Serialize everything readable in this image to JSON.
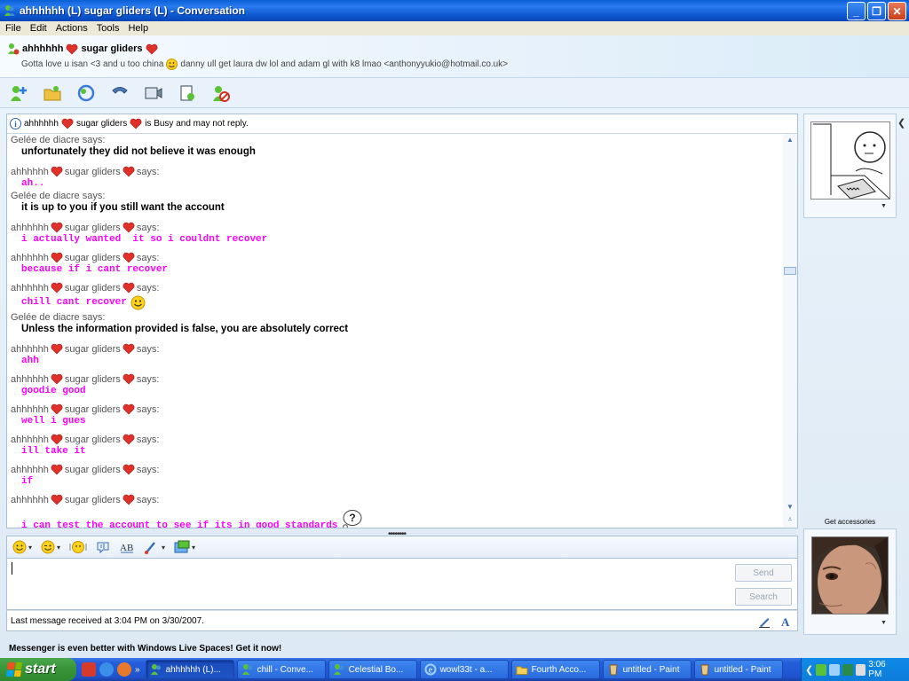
{
  "window": {
    "title": "ahhhhhh (L) sugar gliders (L) - Conversation",
    "controls": [
      "minimize",
      "maximize",
      "close"
    ]
  },
  "menu": [
    "File",
    "Edit",
    "Actions",
    "Tools",
    "Help"
  ],
  "contact": {
    "name_part1": "ahhhhhh",
    "name_part2": "sugar gliders",
    "status_part1": "Gotta love u isan <3 and u too china",
    "status_part2": "danny ull get laura dw lol and adam gl with k8 lmao <anthonyyukio@hotmail.co.uk>"
  },
  "toolbar": [
    "invite-contact-icon",
    "send-files-icon",
    "video-call-icon",
    "call-icon",
    "webcam-icon",
    "activities-icon",
    "block-icon"
  ],
  "busy_notice": {
    "name_part1": "ahhhhhh",
    "name_part2": "sugar gliders",
    "text": "is Busy and may not reply."
  },
  "labels": {
    "other_says": "Gelée de diacre says:",
    "me_name_a": "ahhhhhh",
    "me_name_b": "sugar gliders",
    "me_says": "says:"
  },
  "messages": [
    {
      "from": "other",
      "text": "unfortunately they did not believe it was enough"
    },
    {
      "from": "me",
      "text": "ah.."
    },
    {
      "from": "other",
      "text": "it is up to you if you still want the account"
    },
    {
      "from": "me",
      "text": "i actually wanted  it so i couldnt recover"
    },
    {
      "from": "me",
      "text": "because if i cant recover"
    },
    {
      "from": "me",
      "text": "chill cant recover",
      "emoticon": "smiley"
    },
    {
      "from": "other",
      "text": "Unless the information provided is false, you are absolutely correct"
    },
    {
      "from": "me",
      "text": "ahh"
    },
    {
      "from": "me",
      "text": "goodie good"
    },
    {
      "from": "me",
      "text": "well i gues"
    },
    {
      "from": "me",
      "text": "ill take it"
    },
    {
      "from": "me",
      "text": "if"
    },
    {
      "from": "me",
      "text": "i can test the account to see if its in good standards",
      "emoticon": "thinking"
    }
  ],
  "input": {
    "value": "",
    "send_label": "Send",
    "search_label": "Search"
  },
  "status_bar": "Last message received at 3:04 PM on 3/30/2007.",
  "promo": "Messenger is even better with Windows Live Spaces! Get it now!",
  "side": {
    "get_accessories": "Get accessories"
  },
  "taskbar": {
    "start_label": "start",
    "tasks": [
      {
        "label": "ahhhhhh (L)...",
        "icon": "msn-icon",
        "active": true
      },
      {
        "label": "chill - Conve...",
        "icon": "msn-icon",
        "active": false
      },
      {
        "label": "Celestial Bo...",
        "icon": "msn-icon",
        "active": false
      },
      {
        "label": "wowl33t - a...",
        "icon": "ie-icon",
        "active": false
      },
      {
        "label": "Fourth Acco...",
        "icon": "folder-icon",
        "active": false
      },
      {
        "label": "untitled - Paint",
        "icon": "paint-icon",
        "active": false
      },
      {
        "label": "untitled - Paint",
        "icon": "paint-icon",
        "active": false
      }
    ],
    "clock": "3:06 PM"
  },
  "colors": {
    "pink_text": "#ff00ff",
    "heart": "#e0302a",
    "title_blue": "#0a5fd6"
  }
}
